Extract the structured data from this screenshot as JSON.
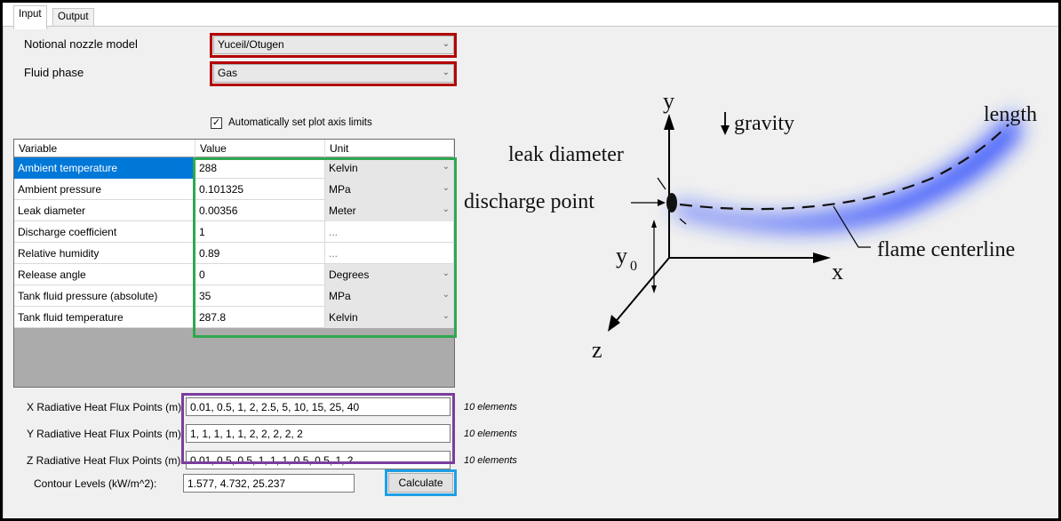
{
  "tabs": [
    {
      "label": "Input"
    },
    {
      "label": "Output"
    }
  ],
  "form": {
    "nozzle_label": "Notional nozzle model",
    "nozzle_value": "Yuceil/Otugen",
    "phase_label": "Fluid phase",
    "phase_value": "Gas",
    "autolimits_label": "Automatically set plot axis limits"
  },
  "grid": {
    "headers": [
      "Variable",
      "Value",
      "Unit"
    ],
    "rows": [
      {
        "variable": "Ambient temperature",
        "value": "288",
        "unit": "Kelvin"
      },
      {
        "variable": "Ambient pressure",
        "value": "0.101325",
        "unit": "MPa"
      },
      {
        "variable": "Leak diameter",
        "value": "0.00356",
        "unit": "Meter"
      },
      {
        "variable": "Discharge coefficient",
        "value": "1",
        "unit": "..."
      },
      {
        "variable": "Relative humidity",
        "value": "0.89",
        "unit": "..."
      },
      {
        "variable": "Release angle",
        "value": "0",
        "unit": "Degrees"
      },
      {
        "variable": "Tank fluid pressure (absolute)",
        "value": "35",
        "unit": "MPa"
      },
      {
        "variable": "Tank fluid temperature",
        "value": "287.8",
        "unit": "Kelvin"
      }
    ]
  },
  "flux": {
    "x_label": "X Radiative Heat Flux Points (m):",
    "x_value": "0.01, 0.5, 1, 2, 2.5, 5, 10, 15, 25, 40",
    "x_count": "10 elements",
    "y_label": "Y Radiative Heat Flux Points (m):",
    "y_value": "1, 1, 1, 1, 1, 2, 2, 2, 2, 2",
    "y_count": "10 elements",
    "z_label": "Z Radiative Heat Flux Points (m):",
    "z_value": "0.01, 0.5, 0.5, 1, 1, 1, 0.5, 0.5, 1, 2",
    "z_count": "10 elements",
    "contour_label": "Contour Levels (kW/m^2):",
    "contour_value": "1.577, 4.732, 25.237",
    "calculate_label": "Calculate"
  },
  "figure": {
    "y_axis": "y",
    "x_axis": "x",
    "z_axis": "z",
    "gravity": "gravity",
    "length": "length",
    "leak_diameter": "leak diameter",
    "discharge_point": "discharge point",
    "flame_centerline": "flame centerline",
    "y0": "y",
    "y0_sub": "0"
  },
  "colors": {
    "red": "#b30000",
    "green": "#2fa84f",
    "purple": "#7a3d9e",
    "blue": "#1ea0e6",
    "flame": "#1a3cff"
  }
}
